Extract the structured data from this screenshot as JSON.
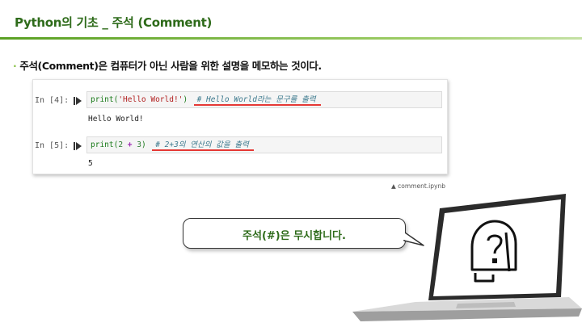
{
  "header": {
    "title": "Python의 기초 _ 주석 (Comment)"
  },
  "bullet": {
    "dot": "·",
    "text": "주석(Comment)은 컴퓨터가 아닌 사람을 위한 설명을 메모하는 것이다."
  },
  "notebook": {
    "cells": [
      {
        "prompt": "In [4]:",
        "code_func": "print(",
        "code_arg": "'Hello World!'",
        "code_close": ")",
        "comment": "# Hello World라는 문구를 출력",
        "output": "Hello World!"
      },
      {
        "prompt": "In [5]:",
        "code_func": "print(",
        "code_num1": "2",
        "code_op": "+",
        "code_num2": "3",
        "code_close": ")",
        "comment": "# 2+3의 연산의 값을 출력",
        "output": "5"
      }
    ]
  },
  "caption": {
    "text": "▲ comment.ipynb"
  },
  "bubble": {
    "text": "주석(#)은 무시합니다."
  },
  "colors": {
    "accent": "#2e6b1a",
    "underline": "#e53935",
    "header_rule": "#5aa023"
  }
}
